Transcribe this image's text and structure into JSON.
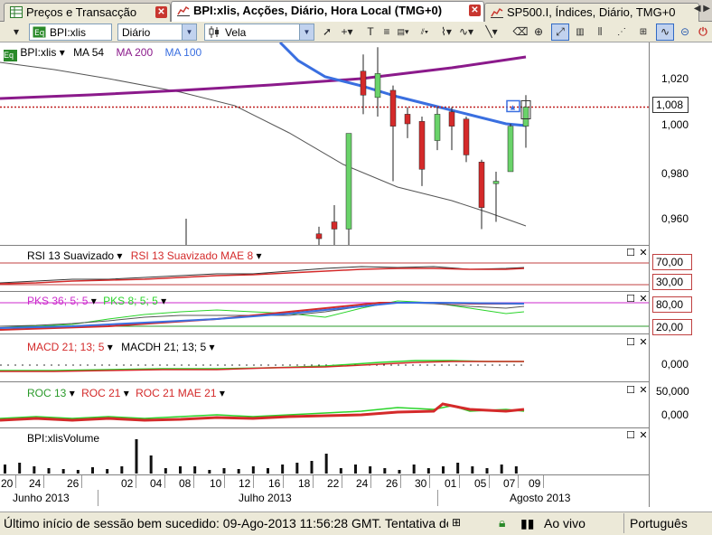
{
  "tabs": [
    {
      "label": "Preços e Transacção",
      "active": false
    },
    {
      "label": "BPI:xlis, Acções, Diário, Hora Local (TMG+0)",
      "active": true
    },
    {
      "label": "SP500.I, Índices, Diário, TMG+0",
      "active": false
    }
  ],
  "toolbar": {
    "symbol": "BPI:xlis",
    "period": "Diário",
    "chart_style": "Vela"
  },
  "main_panel": {
    "legend": {
      "symbol": "BPI:xlis",
      "ma1": "MA 54",
      "ma2": "MA 200",
      "ma3": "MA 100"
    },
    "y_ticks": [
      "1,020",
      "1,000",
      "0,980",
      "0,960"
    ],
    "last_price": "1,008",
    "colors": {
      "ma54": "#555555",
      "ma200": "#8b1a8b",
      "ma100": "#3a6fe0",
      "up": "#6ad36a",
      "down": "#d42a2a"
    }
  },
  "rsi_panel": {
    "label1": "RSI 13 Suavizado",
    "label2": "RSI 13 Suavizado MAE 8",
    "upper": "70,00",
    "lower": "30,00"
  },
  "pks_panel": {
    "label1": "PKS 36; 5; 5",
    "label2": "PKS 8; 5; 5",
    "upper": "80,00",
    "lower": "20,00"
  },
  "macd_panel": {
    "label1": "MACD 21; 13; 5",
    "label2": "MACDH 21; 13; 5",
    "zero": "0,000"
  },
  "roc_panel": {
    "label1": "ROC 13",
    "label2": "ROC 21",
    "label3": "ROC 21 MAE 21",
    "top": "50,000",
    "zero": "0,000"
  },
  "volume_panel": {
    "label": "BPI:xlisVolume"
  },
  "x_axis": {
    "days": [
      "20",
      "24",
      "26",
      "02",
      "04",
      "08",
      "10",
      "12",
      "16",
      "18",
      "22",
      "24",
      "26",
      "30",
      "01",
      "05",
      "07",
      "09"
    ],
    "months": [
      "Junho 2013",
      "Julho 2013",
      "Agosto 2013"
    ]
  },
  "status_bar": {
    "message": "Último início de sessão bem sucedido: 09-Ago-2013 11:56:28 GMT. Tentativa de",
    "connection": "Ao vivo",
    "language": "Português"
  },
  "chart_data": {
    "type": "candlestick",
    "dates": [
      "22",
      "23",
      "24",
      "25",
      "26",
      "29",
      "30",
      "31",
      "01",
      "02",
      "05",
      "06",
      "07",
      "08",
      "09"
    ],
    "candles": [
      {
        "open": 0.955,
        "high": 0.958,
        "low": 0.95,
        "close": 0.953
      },
      {
        "open": 0.96,
        "high": 0.967,
        "low": 0.945,
        "close": 0.957
      },
      {
        "open": 0.957,
        "high": 0.977,
        "low": 0.95,
        "close": 0.997
      },
      {
        "open": 1.023,
        "high": 1.03,
        "low": 1.005,
        "close": 1.013
      },
      {
        "open": 1.012,
        "high": 1.033,
        "low": 1.004,
        "close": 1.022
      },
      {
        "open": 1.015,
        "high": 1.017,
        "low": 0.977,
        "close": 1.0
      },
      {
        "open": 1.005,
        "high": 1.008,
        "low": 0.995,
        "close": 1.001
      },
      {
        "open": 1.002,
        "high": 1.004,
        "low": 0.975,
        "close": 0.982
      },
      {
        "open": 0.994,
        "high": 1.008,
        "low": 0.99,
        "close": 1.005
      },
      {
        "open": 1.006,
        "high": 1.008,
        "low": 0.99,
        "close": 1.0
      },
      {
        "open": 1.003,
        "high": 1.004,
        "low": 0.985,
        "close": 0.988
      },
      {
        "open": 0.985,
        "high": 0.986,
        "low": 0.957,
        "close": 0.966
      },
      {
        "open": 0.976,
        "high": 0.981,
        "low": 0.96,
        "close": 0.977
      },
      {
        "open": 0.981,
        "high": 1.001,
        "low": 0.981,
        "close": 1.0
      },
      {
        "open": 1.0,
        "high": 1.013,
        "low": 0.991,
        "close": 1.008
      }
    ],
    "ylim": [
      0.95,
      1.035
    ]
  }
}
